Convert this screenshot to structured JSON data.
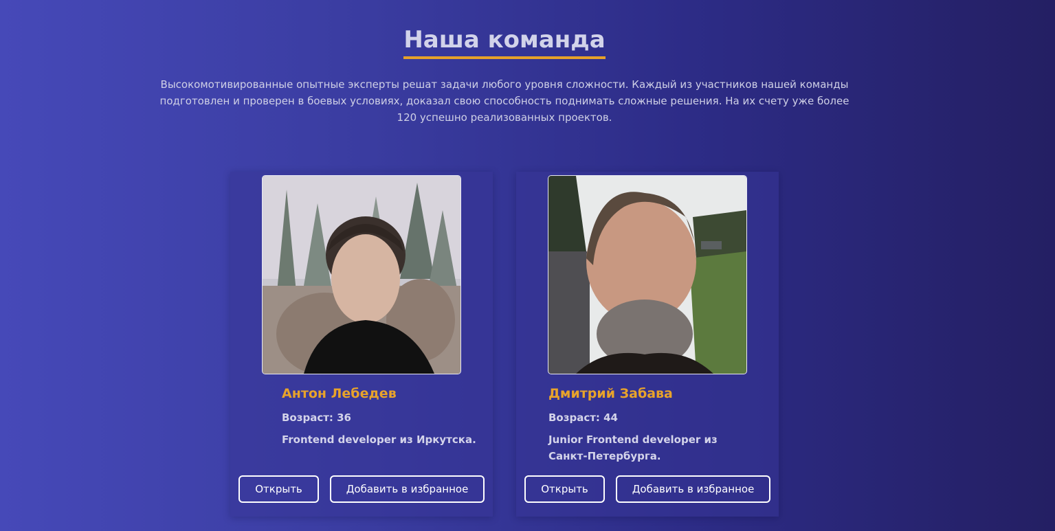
{
  "section": {
    "title": "Наша команда",
    "description": "Высокомотивированные опытные эксперты решат задачи любого уровня сложности. Каждый из участников нашей команды подготовлен и проверен в боевых условиях, доказал свою способность поднимать сложные решения. На их счету уже более 120 успешно реализованных проектов."
  },
  "team": [
    {
      "name": "Антон Лебедев",
      "age": "Возраст: 36",
      "role": "Frontend developer из Иркутска.",
      "open_label": "Открыть",
      "favorite_label": "Добавить в избранное"
    },
    {
      "name": "Дмитрий Забава",
      "age": "Возраст: 44",
      "role": "Junior Frontend developer из Санкт-Петербурга.",
      "open_label": "Открыть",
      "favorite_label": "Добавить в избранное"
    }
  ],
  "colors": {
    "accent": "#e8a32b",
    "background_start": "#4649b8",
    "background_end": "#241f63"
  }
}
